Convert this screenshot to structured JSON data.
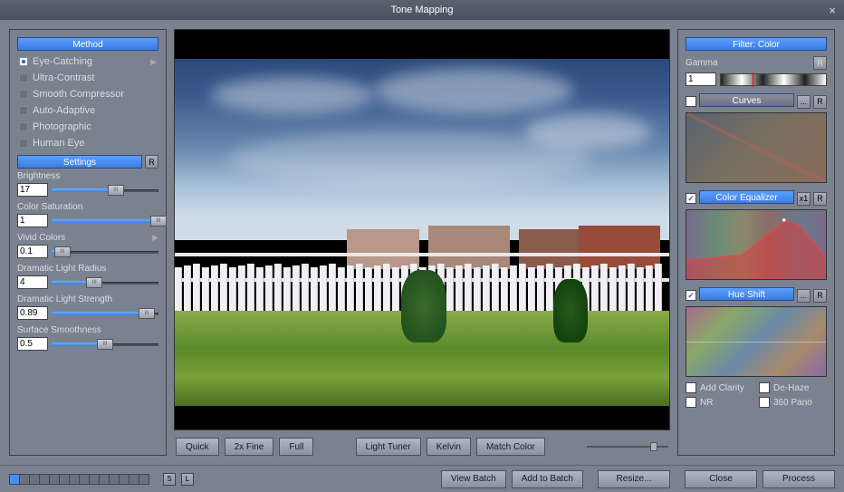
{
  "window": {
    "title": "Tone Mapping"
  },
  "left": {
    "method_header": "Method",
    "methods": [
      "Eye-Catching",
      "Ultra-Contrast",
      "Smooth Compressor",
      "Auto-Adaptive",
      "Photographic",
      "Human Eye"
    ],
    "selected_method": 0,
    "settings_header": "Settings",
    "reset": "R",
    "settings": {
      "brightness": {
        "label": "Brightness",
        "value": "17",
        "pct": 60
      },
      "saturation": {
        "label": "Color Saturation",
        "value": "1",
        "pct": 100
      },
      "vivid": {
        "label": "Vivid Colors",
        "value": "0.1",
        "pct": 10
      },
      "radius": {
        "label": "Dramatic Light Radius",
        "value": "4",
        "pct": 40
      },
      "strength": {
        "label": "Dramatic Light Strength",
        "value": "0.89",
        "pct": 89
      },
      "smoothness": {
        "label": "Surface Smoothness",
        "value": "0.5",
        "pct": 50
      }
    }
  },
  "center": {
    "quick": "Quick",
    "fine": "2x Fine",
    "full": "Full",
    "light_tuner": "Light Tuner",
    "kelvin": "Kelvin",
    "match_color": "Match Color"
  },
  "right": {
    "filter_header": "Filter: Color",
    "gamma_label": "Gamma",
    "gamma_value": "1",
    "reset": "R",
    "curves_header": "Curves",
    "ellipsis": "...",
    "eq_header": "Color Equalizer",
    "x1": "x1",
    "hue_header": "Hue Shift",
    "checks": {
      "add_clarity": "Add Clarity",
      "de_haze": "De-Haze",
      "nr": "NR",
      "pano": "360 Pano"
    }
  },
  "bottom": {
    "presets": 14,
    "s": "S",
    "l": "L",
    "view_batch": "View Batch",
    "add_batch": "Add to Batch",
    "resize": "Resize...",
    "close": "Close",
    "process": "Process"
  }
}
